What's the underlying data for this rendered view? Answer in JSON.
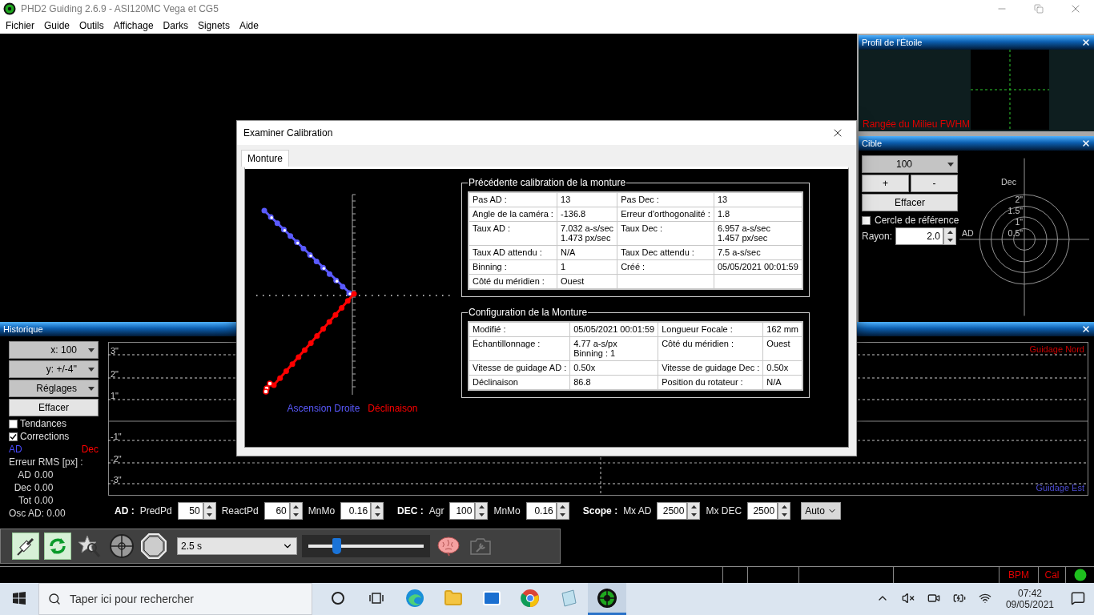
{
  "window": {
    "title": "PHD2 Guiding 2.6.9 - ASI120MC Vega et CG5"
  },
  "menu": [
    "Fichier",
    "Guide",
    "Outils",
    "Affichage",
    "Darks",
    "Signets",
    "Aide"
  ],
  "star_profile": {
    "title": "Profil de l'Étoile",
    "caption": "Rangée du Milieu FWHM"
  },
  "target": {
    "title": "Cible",
    "zoom": "100",
    "plus": "+",
    "minus": "-",
    "clear": "Effacer",
    "reference_circle": {
      "label": "Cercle de référence",
      "checked": false
    },
    "radius_label": "Rayon:",
    "radius": "2.0",
    "dec_label": "Dec",
    "ad_label": "AD",
    "ring_labels": [
      "2\"",
      "1.5\"",
      "1\"",
      "0.5\""
    ]
  },
  "history": {
    "title": "Historique",
    "dropdowns": [
      "x: 100",
      "y: +/-4''",
      "Réglages"
    ],
    "clear": "Effacer",
    "options": [
      {
        "label": "Tendances",
        "checked": false
      },
      {
        "label": "Corrections",
        "checked": true
      }
    ],
    "legend": [
      {
        "label": "AD",
        "color": "#4a4aff"
      },
      {
        "label": "Dec",
        "color": "#ff0000"
      }
    ],
    "rms_title": "Erreur RMS [px] :",
    "rms": [
      {
        "label": "AD",
        "value": "0.00"
      },
      {
        "label": "Dec",
        "value": "0.00"
      },
      {
        "label": "Tot",
        "value": "0.00"
      }
    ],
    "osc": "Osc AD: 0.00",
    "y_labels": [
      "3\"",
      "2\"",
      "1\"",
      "-1\"",
      "-2\"",
      "-3\""
    ],
    "north_label": "Guidage Nord",
    "east_label": "Guidage Est"
  },
  "guide_params": {
    "groups": [
      {
        "title": "AD :",
        "fields": [
          {
            "label": "PredPd",
            "value": "50"
          },
          {
            "label": "ReactPd",
            "value": "60"
          },
          {
            "label": "MnMo",
            "value": "0.16"
          }
        ]
      },
      {
        "title": "DEC :",
        "fields": [
          {
            "label": "Agr",
            "value": "100"
          },
          {
            "label": "MnMo",
            "value": "0.16"
          }
        ]
      },
      {
        "title": "Scope :",
        "fields": [
          {
            "label": "Mx AD",
            "value": "2500"
          },
          {
            "label": "Mx DEC",
            "value": "2500"
          }
        ]
      }
    ],
    "mode": "Auto"
  },
  "toolbar": {
    "exposure": "2.5 s",
    "level": 0.24
  },
  "status_bar": {
    "bpm": "BPM",
    "cal": "Cal"
  },
  "dialog": {
    "title": "Examiner Calibration",
    "tabs": [
      {
        "label": "Monture",
        "selected": true
      }
    ],
    "legend": [
      {
        "label": "Ascension Droite",
        "color": "#5a5aff"
      },
      {
        "label": "Déclinaison",
        "color": "#ff0000"
      }
    ],
    "previous": {
      "title": "Précédente calibration de la monture",
      "rows": [
        [
          "Pas AD :",
          "13",
          "Pas Dec :",
          "13"
        ],
        [
          "Angle de la caméra :",
          "-136.8",
          "Erreur d'orthogonalité :",
          "1.8"
        ],
        [
          "Taux AD :",
          "7.032 a-s/sec\n1.473 px/sec",
          "Taux Dec :",
          "6.957 a-s/sec\n1.457 px/sec"
        ],
        [
          "Taux AD attendu :",
          "N/A",
          "Taux Dec attendu :",
          "7.5 a-s/sec"
        ],
        [
          "Binning :",
          "1",
          "Créé :",
          "05/05/2021 00:01:59"
        ],
        [
          "Côté du méridien :",
          "Ouest"
        ]
      ]
    },
    "config": {
      "title": "Configuration de la Monture",
      "rows": [
        [
          "Modifié :",
          "05/05/2021 00:01:59",
          "Longueur Focale :",
          "162 mm"
        ],
        [
          "Échantillonnage :",
          "4.77 a-s/px\nBinning : 1",
          "Côté du méridien :",
          "Ouest"
        ],
        [
          "Vitesse de guidage AD :",
          "0.50x",
          "Vitesse de guidage Dec :",
          "0.50x"
        ],
        [
          "Déclinaison",
          "86.8",
          "Position du rotateur :",
          "N/A"
        ]
      ]
    }
  },
  "taskbar": {
    "search_placeholder": "Taper ici pour rechercher",
    "time": "07:42",
    "date": "09/05/2021"
  }
}
